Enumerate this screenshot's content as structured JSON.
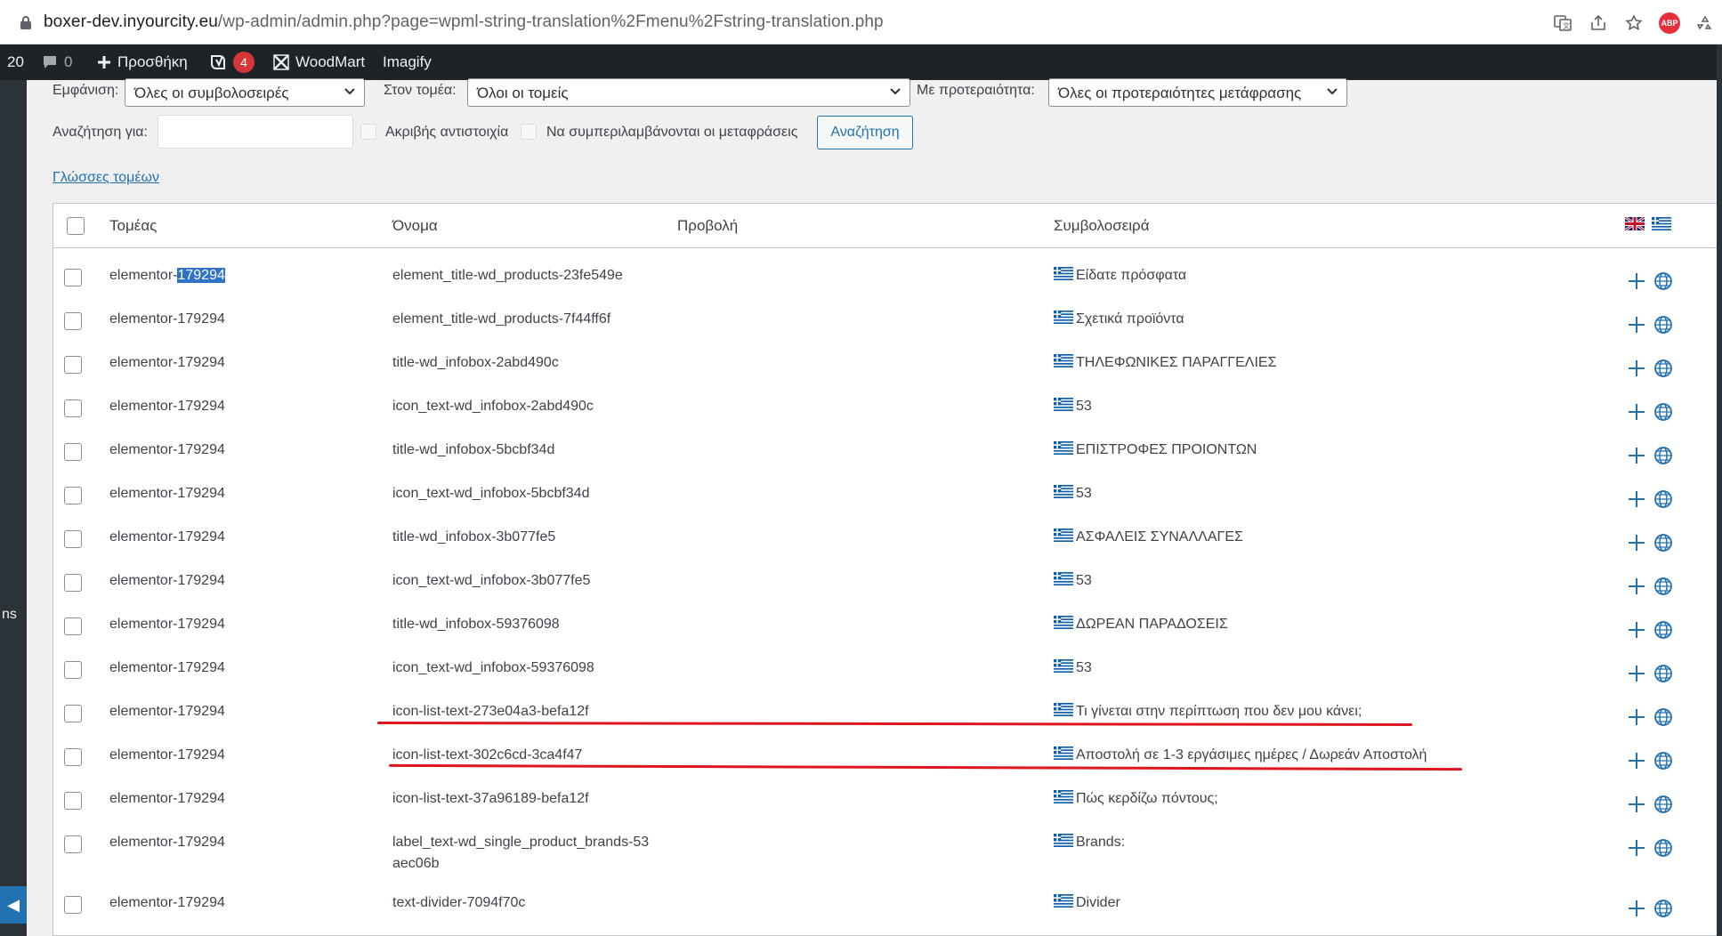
{
  "browser": {
    "url_host": "boxer-dev.inyourcity.eu",
    "url_path": "/wp-admin/admin.php?page=wpml-string-translation%2Fmenu%2Fstring-translation.php",
    "abp_label": "ABP"
  },
  "adminbar": {
    "partial_count": "20",
    "comments_count": "0",
    "add_new_label": "Προσθήκη",
    "yoast_count": "4",
    "woodmart_label": "WoodMart",
    "imagify_label": "Imagify"
  },
  "sidebar": {
    "partial_label": "ns"
  },
  "filters": {
    "display_label": "Εμφάνιση:",
    "display_value": "Όλες οι συμβολοσειρές",
    "domain_label": "Στον τομέα:",
    "domain_value": "Όλοι οι τομείς",
    "priority_label": "Με προτεραιότητα:",
    "priority_value": "Όλες οι προτεραιότητες μετάφρασης",
    "search_label": "Αναζήτηση για:",
    "search_value": "",
    "exact_match_label": "Ακριβής αντιστοιχία",
    "include_translations_label": "Να συμπεριλαμβάνονται οι μεταφράσεις",
    "search_button": "Αναζήτηση",
    "domain_languages_link": "Γλώσσες τομέων"
  },
  "table": {
    "headers": {
      "domain": "Τομέας",
      "name": "Όνομα",
      "view": "Προβολή",
      "string": "Συμβολοσειρά"
    },
    "rows": [
      {
        "domain": "elementor-179294",
        "domain_prefix": "elementor-",
        "domain_selected": "179294",
        "name": "element_title-wd_products-23fe549e",
        "name2": "",
        "string": "Είδατε πρόσφατα"
      },
      {
        "domain": "elementor-179294",
        "name": "element_title-wd_products-7f44ff6f",
        "name2": "",
        "string": "Σχετικά προϊόντα"
      },
      {
        "domain": "elementor-179294",
        "name": "title-wd_infobox-2abd490c",
        "name2": "",
        "string": "ΤΗΛΕΦΩΝΙΚΕΣ ΠΑΡΑΓΓΕΛΙΕΣ"
      },
      {
        "domain": "elementor-179294",
        "name": "icon_text-wd_infobox-2abd490c",
        "name2": "",
        "string": "53"
      },
      {
        "domain": "elementor-179294",
        "name": "title-wd_infobox-5bcbf34d",
        "name2": "",
        "string": "ΕΠΙΣΤΡΟΦΕΣ ΠΡΟΙΟΝΤΩΝ"
      },
      {
        "domain": "elementor-179294",
        "name": "icon_text-wd_infobox-5bcbf34d",
        "name2": "",
        "string": "53"
      },
      {
        "domain": "elementor-179294",
        "name": "title-wd_infobox-3b077fe5",
        "name2": "",
        "string": "ΑΣΦΑΛΕΙΣ ΣΥΝΑΛΛΑΓΕΣ"
      },
      {
        "domain": "elementor-179294",
        "name": "icon_text-wd_infobox-3b077fe5",
        "name2": "",
        "string": "53"
      },
      {
        "domain": "elementor-179294",
        "name": "title-wd_infobox-59376098",
        "name2": "",
        "string": "ΔΩΡΕΑΝ ΠΑΡΑΔΟΣΕΙΣ"
      },
      {
        "domain": "elementor-179294",
        "name": "icon_text-wd_infobox-59376098",
        "name2": "",
        "string": "53"
      },
      {
        "domain": "elementor-179294",
        "name": "icon-list-text-273e04a3-befa12f",
        "name2": "",
        "string": "Τι γίνεται στην περίπτωση που δεν μου κάνει;"
      },
      {
        "domain": "elementor-179294",
        "name": "icon-list-text-302c6cd-3ca4f47",
        "name2": "",
        "string": "Αποστολή σε 1-3 εργάσιμες ημέρες / Δωρεάν Αποστολή"
      },
      {
        "domain": "elementor-179294",
        "name": "icon-list-text-37a96189-befa12f",
        "name2": "",
        "string": "Πώς κερδίζω πόντους;"
      },
      {
        "domain": "elementor-179294",
        "name": "label_text-wd_single_product_brands-53",
        "name2": "aec06b",
        "string": "Brands:"
      },
      {
        "domain": "elementor-179294",
        "name": "text-divider-7094f70c",
        "name2": "",
        "string": "Divider"
      }
    ]
  },
  "colors": {
    "accent": "#2271b1",
    "adminbar": "#1d2327",
    "highlight_line": "#e0161e",
    "selection": "#2e73c7"
  }
}
